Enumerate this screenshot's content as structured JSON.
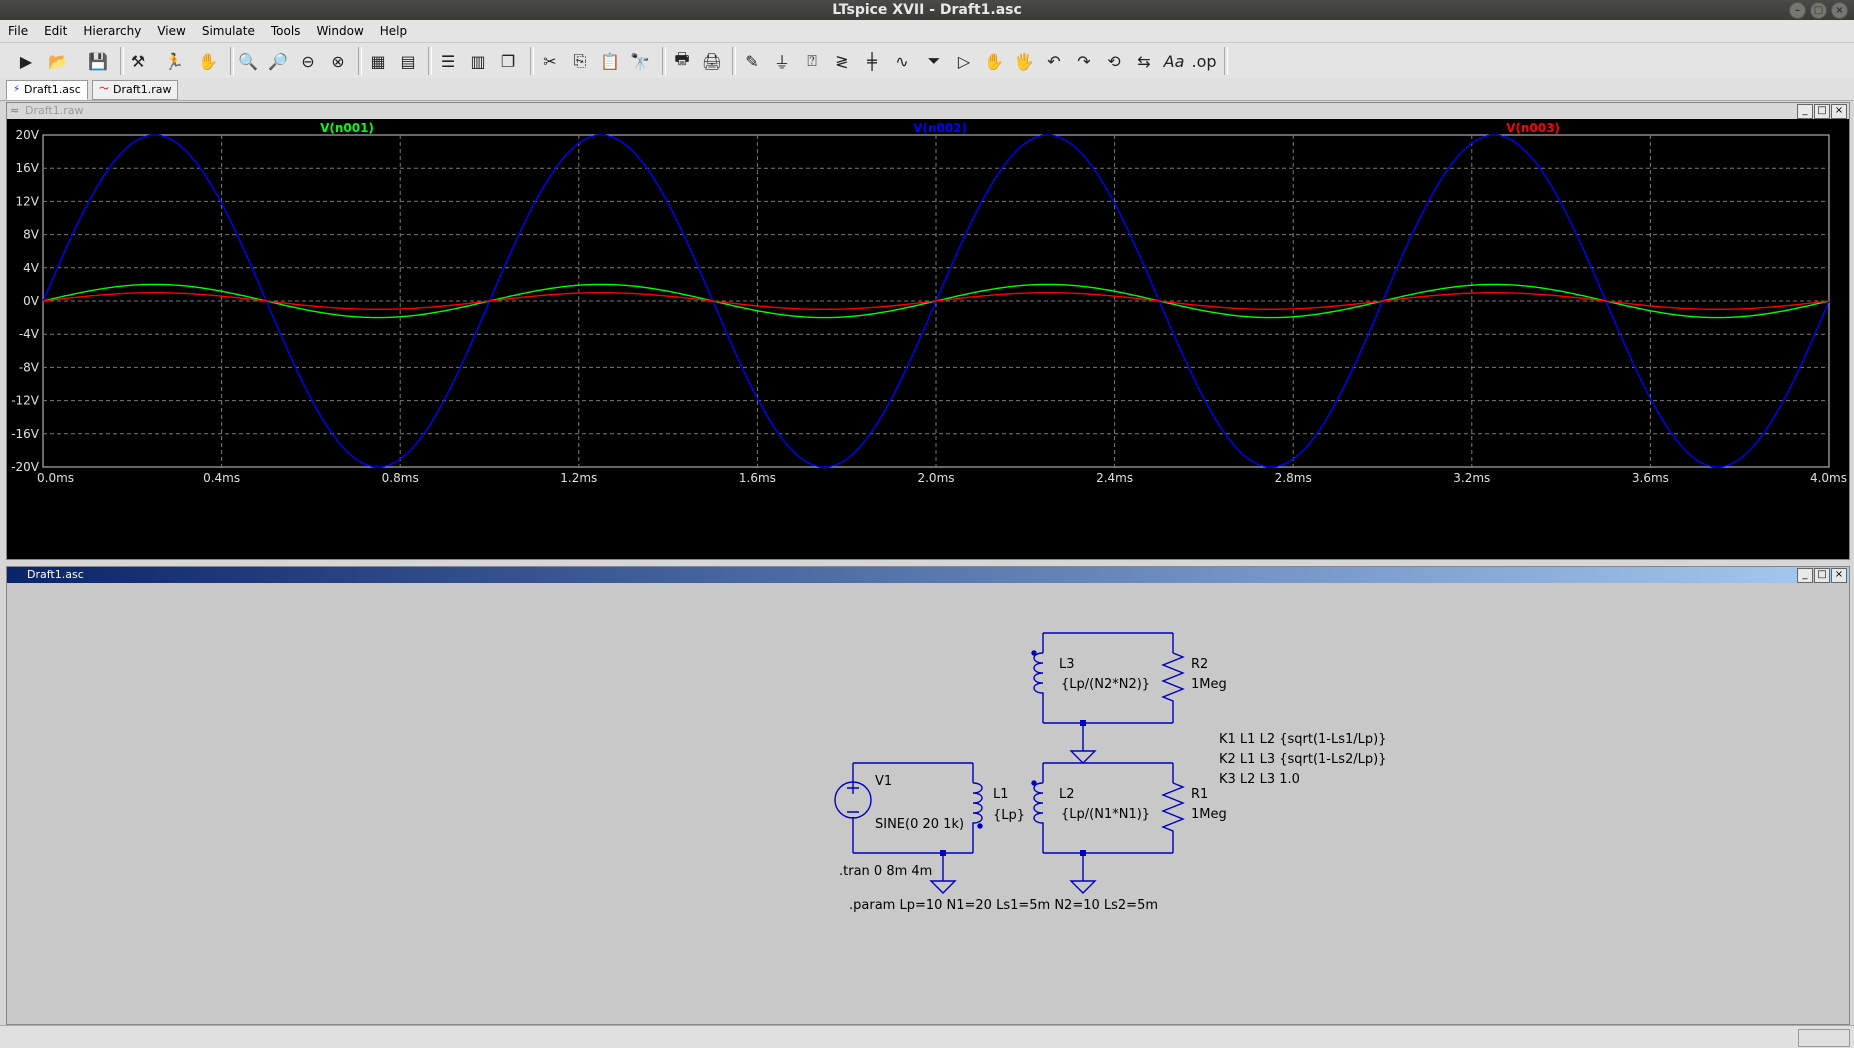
{
  "window": {
    "title": "LTspice XVII - Draft1.asc"
  },
  "menu": [
    "File",
    "Edit",
    "Hierarchy",
    "View",
    "Simulate",
    "Tools",
    "Window",
    "Help"
  ],
  "tabs": [
    {
      "label": "Draft1.asc",
      "icon": "schematic-icon",
      "active": true
    },
    {
      "label": "Draft1.raw",
      "icon": "waveform-icon",
      "active": false
    }
  ],
  "waveform": {
    "pane_title": "Draft1.raw",
    "traces": [
      {
        "name": "V(n001)",
        "color": "#00ff00"
      },
      {
        "name": "V(n002)",
        "color": "#0000ff"
      },
      {
        "name": "V(n003)",
        "color": "#ff0000"
      }
    ],
    "y_ticks": [
      "20V",
      "16V",
      "12V",
      "8V",
      "4V",
      "0V",
      "-4V",
      "-8V",
      "-12V",
      "-16V",
      "-20V"
    ],
    "x_ticks": [
      "0.0ms",
      "0.4ms",
      "0.8ms",
      "1.2ms",
      "1.6ms",
      "2.0ms",
      "2.4ms",
      "2.8ms",
      "3.2ms",
      "3.6ms",
      "4.0ms"
    ]
  },
  "chart_data": {
    "type": "line",
    "xlabel": "",
    "ylabel": "",
    "x_unit": "ms",
    "xlim": [
      0,
      4.0
    ],
    "ylim": [
      -20,
      20
    ],
    "grid": true,
    "legend": "top",
    "series": [
      {
        "name": "V(n001)",
        "color": "#00ff00",
        "amplitude": 2,
        "frequency_khz": 1
      },
      {
        "name": "V(n002)",
        "color": "#0000ff",
        "amplitude": 20,
        "frequency_khz": 1
      },
      {
        "name": "V(n003)",
        "color": "#ff0000",
        "amplitude": 1,
        "frequency_khz": 1
      }
    ]
  },
  "schematic": {
    "pane_title": "Draft1.asc",
    "v1": {
      "name": "V1",
      "value": "SINE(0 20 1k)"
    },
    "l1": {
      "name": "L1",
      "value": "{Lp}"
    },
    "l2": {
      "name": "L2",
      "value": "{Lp/(N1*N1)}"
    },
    "l3": {
      "name": "L3",
      "value": "{Lp/(N2*N2)}"
    },
    "r1": {
      "name": "R1",
      "value": "1Meg"
    },
    "r2": {
      "name": "R2",
      "value": "1Meg"
    },
    "k_lines": [
      "K1 L1 L2 {sqrt(1-Ls1/Lp)}",
      "K2 L1 L3 {sqrt(1-Ls2/Lp)}",
      "K3 L2 L3 1.0"
    ],
    "tran": ".tran 0 8m 4m",
    "param": ".param Lp=10 N1=20 Ls1=5m N2=10 Ls2=5m"
  }
}
